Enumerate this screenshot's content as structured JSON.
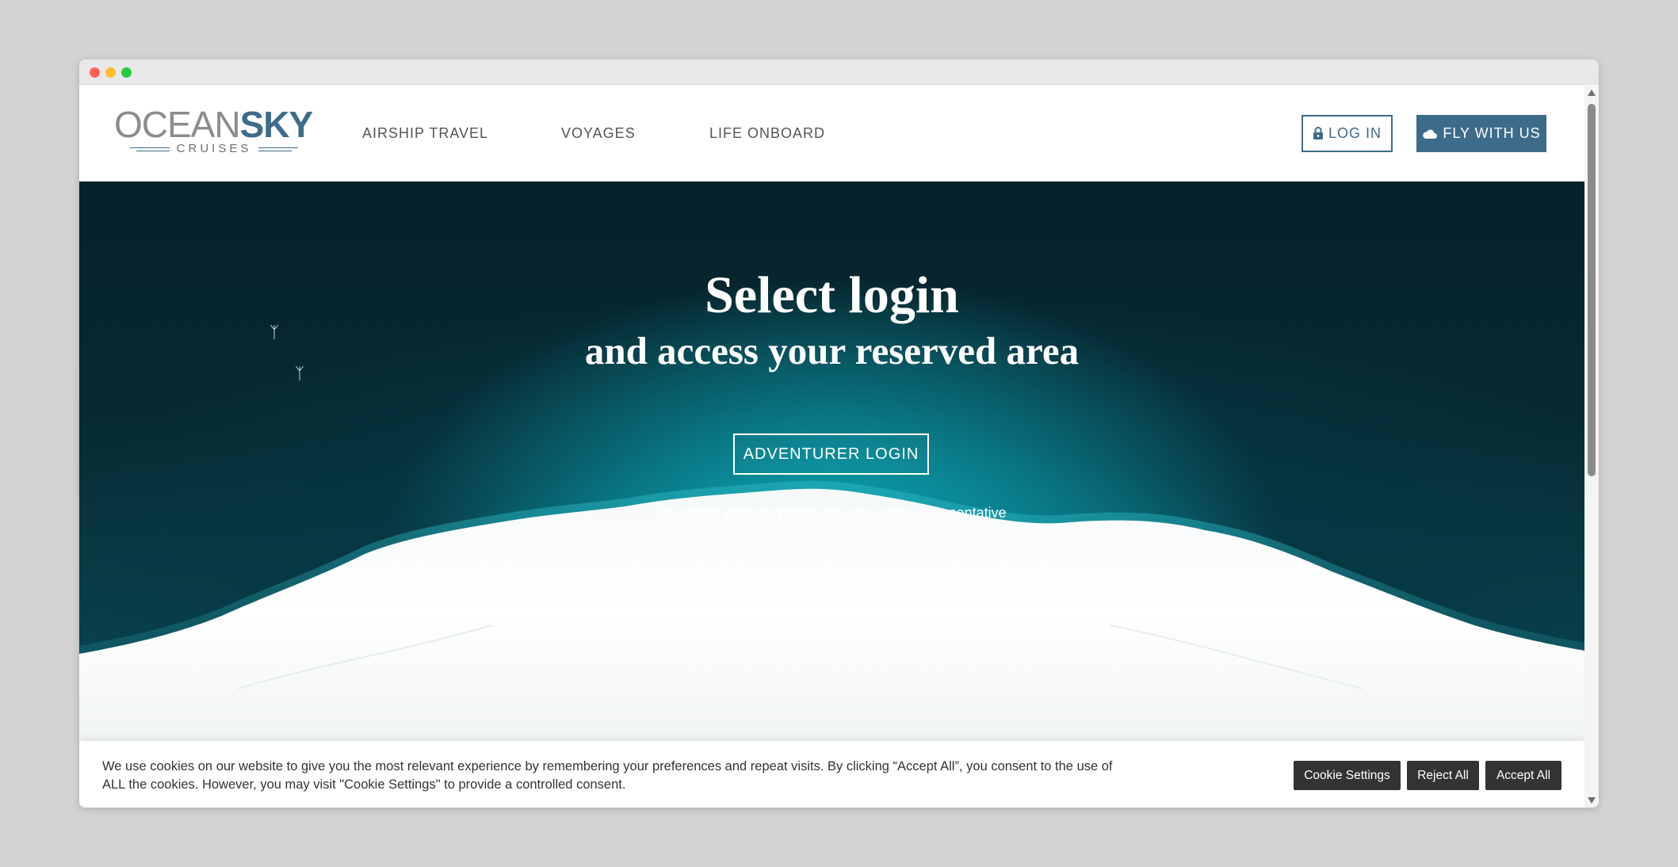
{
  "brand": {
    "name_part1": "OCEAN",
    "name_part2": "SKY",
    "tagline": "CRUISES",
    "primary_color": "#3d6c8a"
  },
  "nav": {
    "items": [
      {
        "label": "AIRSHIP TRAVEL"
      },
      {
        "label": "VOYAGES"
      },
      {
        "label": "LIFE ONBOARD"
      }
    ]
  },
  "header_actions": {
    "login_label": "LOG IN",
    "login_icon": "lock-icon",
    "fly_label": "FLY WITH US",
    "fly_icon": "cloud-icon"
  },
  "hero": {
    "title": "Select login",
    "subtitle": "and access your reserved area",
    "button_label": "ADVENTURER LOGIN",
    "note": "To access Pioneer pages ask your sales representative"
  },
  "cookie_banner": {
    "text": "We use cookies on our website to give you the most relevant experience by remembering your preferences and repeat visits. By clicking “Accept All”, you consent to the use of ALL the cookies. However, you may visit \"Cookie Settings\" to provide a controlled consent.",
    "settings_label": "Cookie Settings",
    "reject_label": "Reject All",
    "accept_label": "Accept All",
    "button_color": "#333333"
  }
}
